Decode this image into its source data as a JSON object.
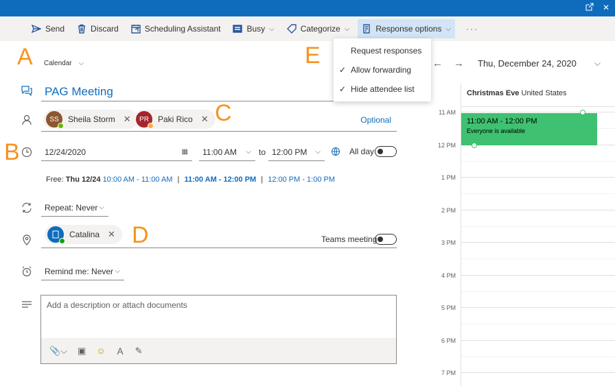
{
  "toolbar": {
    "send": "Send",
    "discard": "Discard",
    "scheduling_assistant": "Scheduling Assistant",
    "busy": "Busy",
    "categorize": "Categorize",
    "response_options": "Response options",
    "more": "···"
  },
  "response_menu": {
    "items": [
      {
        "label": "Request responses",
        "checked": false
      },
      {
        "label": "Allow forwarding",
        "checked": true
      },
      {
        "label": "Hide attendee list",
        "checked": true
      }
    ]
  },
  "annotations": {
    "a": "A",
    "b": "B",
    "c": "C",
    "d": "D",
    "e": "E"
  },
  "calendar_select": {
    "label": "Calendar"
  },
  "event": {
    "title": "PAG Meeting",
    "attendees": [
      {
        "initials": "SS",
        "name": "Sheila Storm",
        "avatar_color": "#8e562e",
        "presence_color": "#6bb700"
      },
      {
        "initials": "PR",
        "name": "Paki Rico",
        "avatar_color": "#a4262c",
        "presence_color": "#ffaa44"
      }
    ],
    "optional_label": "Optional",
    "start_date": "12/24/2020",
    "start_time": "11:00 AM",
    "to_label": "to",
    "end_time": "12:00 PM",
    "all_day_label": "All day",
    "free_prefix": "Free:",
    "free_day": "Thu 12/24",
    "free_slots": [
      "10:00 AM - 11:00 AM",
      "11:00 AM - 12:00 PM",
      "12:00 PM - 1:00 PM"
    ],
    "repeat": "Repeat: Never",
    "location": "Catalina",
    "teams_meeting_label": "Teams meeting",
    "remind": "Remind me: Never",
    "description_placeholder": "Add a description or attach documents"
  },
  "calendar_panel": {
    "date": "Thu, December 24, 2020",
    "holiday_name": "Christmas Eve",
    "holiday_region": "United States",
    "hours": [
      "11 AM",
      "12 PM",
      "1 PM",
      "2 PM",
      "3 PM",
      "4 PM",
      "5 PM",
      "6 PM",
      "7 PM"
    ],
    "event_time": "11:00 AM - 12:00 PM",
    "event_status": "Everyone is available"
  },
  "colors": {
    "accent": "#0f6cbd",
    "event": "#3ec170",
    "annotation": "#f7931e"
  }
}
